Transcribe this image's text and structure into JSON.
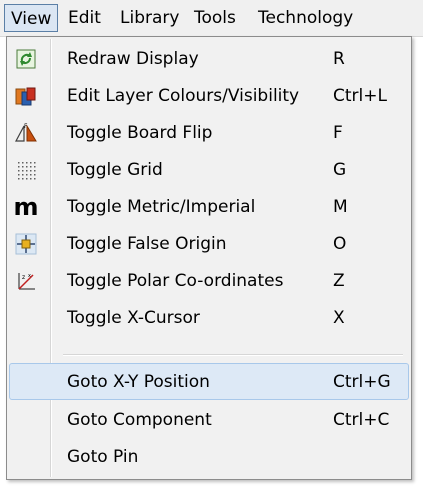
{
  "menubar": {
    "items": [
      "View",
      "Edit",
      "Library",
      "Tools",
      "Technology"
    ]
  },
  "menu": {
    "items": [
      {
        "label": "Redraw Display",
        "shortcut": "R",
        "icon": "redraw-icon"
      },
      {
        "label": "Edit Layer Colours/Visibility",
        "shortcut": "Ctrl+L",
        "icon": "layers-icon"
      },
      {
        "label": "Toggle Board Flip",
        "shortcut": "F",
        "icon": "board-flip-icon"
      },
      {
        "label": "Toggle Grid",
        "shortcut": "G",
        "icon": "grid-icon"
      },
      {
        "label": "Toggle Metric/Imperial",
        "shortcut": "M",
        "icon": "metric-imperial-icon"
      },
      {
        "label": "Toggle False Origin",
        "shortcut": "O",
        "icon": "false-origin-icon"
      },
      {
        "label": "Toggle Polar Co-ordinates",
        "shortcut": "Z",
        "icon": "polar-coordinates-icon"
      },
      {
        "label": "Toggle X-Cursor",
        "shortcut": "X",
        "icon": ""
      },
      {
        "label": "Goto X-Y Position",
        "shortcut": "Ctrl+G",
        "icon": ""
      },
      {
        "label": "Goto Component",
        "shortcut": "Ctrl+C",
        "icon": ""
      },
      {
        "label": "Goto Pin",
        "shortcut": "",
        "icon": ""
      }
    ],
    "metric_icon_glyph": "m",
    "highlighted_item": "Goto X-Y Position"
  },
  "colors": {
    "highlight": "#dde9f6",
    "menu_background": "#f1f1f1",
    "active_menubar": "#dbe6f3"
  }
}
